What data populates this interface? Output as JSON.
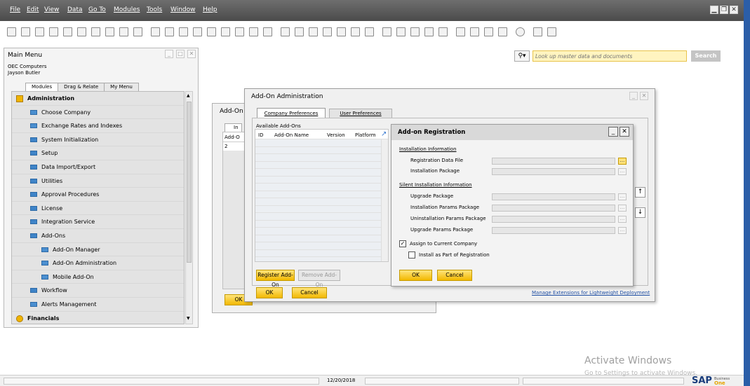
{
  "menubar": {
    "items": [
      "File",
      "Edit",
      "View",
      "Data",
      "Go To",
      "Modules",
      "Tools",
      "Window",
      "Help"
    ]
  },
  "search": {
    "placeholder": "Look up master data and documents",
    "button": "Search"
  },
  "main_menu": {
    "title": "Main Menu",
    "company": "OEC Computers",
    "user": "Jayson Butler",
    "tabs": [
      "Modules",
      "Drag & Relate",
      "My Menu"
    ],
    "items": [
      {
        "label": "Administration",
        "level": 0,
        "icon": "admin-icon"
      },
      {
        "label": "Choose Company",
        "level": 1,
        "icon": "window-icon"
      },
      {
        "label": "Exchange Rates and Indexes",
        "level": 1,
        "icon": "window-icon"
      },
      {
        "label": "System Initialization",
        "level": 1,
        "icon": "folder-icon"
      },
      {
        "label": "Setup",
        "level": 1,
        "icon": "folder-icon"
      },
      {
        "label": "Data Import/Export",
        "level": 1,
        "icon": "folder-icon"
      },
      {
        "label": "Utilities",
        "level": 1,
        "icon": "folder-icon"
      },
      {
        "label": "Approval Procedures",
        "level": 1,
        "icon": "folder-icon"
      },
      {
        "label": "License",
        "level": 1,
        "icon": "folder-icon"
      },
      {
        "label": "Integration Service",
        "level": 1,
        "icon": "folder-icon"
      },
      {
        "label": "Add-Ons",
        "level": 1,
        "icon": "folder-open-icon"
      },
      {
        "label": "Add-On Manager",
        "level": 2,
        "icon": "window-icon"
      },
      {
        "label": "Add-On Administration",
        "level": 2,
        "icon": "window-icon"
      },
      {
        "label": "Mobile Add-On",
        "level": 2,
        "icon": "window-icon"
      },
      {
        "label": "Workflow",
        "level": 1,
        "icon": "folder-icon"
      },
      {
        "label": "Alerts Management",
        "level": 1,
        "icon": "window-icon"
      },
      {
        "label": "Financials",
        "level": 0,
        "icon": "financials-icon"
      }
    ]
  },
  "bg_window": {
    "title": "Add-On",
    "tab": "In",
    "col": "Add-O",
    "row_value": "2",
    "ok": "OK"
  },
  "addon_admin": {
    "title": "Add-On Administration",
    "tabs": [
      "Company Preferences",
      "User Preferences"
    ],
    "available_label": "Available Add-Ons",
    "columns": [
      "ID",
      "Add-On Name",
      "Version",
      "Platform"
    ],
    "register_btn": "Register Add-On",
    "remove_btn": "Remove Add-On",
    "ok": "OK",
    "cancel": "Cancel",
    "link": "Manage Extensions for Lightweight Deployment"
  },
  "registration": {
    "title": "Add-on Registration",
    "installation_header": "Installation Information",
    "reg_file": "Registration Data File",
    "install_pkg": "Installation Package",
    "silent_header": "Silent Installation Information",
    "upgrade_pkg": "Upgrade Package",
    "install_params": "Installation Params Package",
    "uninstall_params": "Uninstallation Params Package",
    "upgrade_params": "Upgrade Params Package",
    "assign": "Assign to Current Company",
    "install_part": "Install as Part of Registration",
    "browse": "...",
    "ok": "OK",
    "cancel": "Cancel"
  },
  "status": {
    "date": "12/20/2018"
  },
  "watermark": {
    "line1": "Activate Windows",
    "line2": "Go to Settings to activate Windows."
  },
  "brand": {
    "name": "SAP",
    "sub1": "Business",
    "sub2": "One"
  }
}
